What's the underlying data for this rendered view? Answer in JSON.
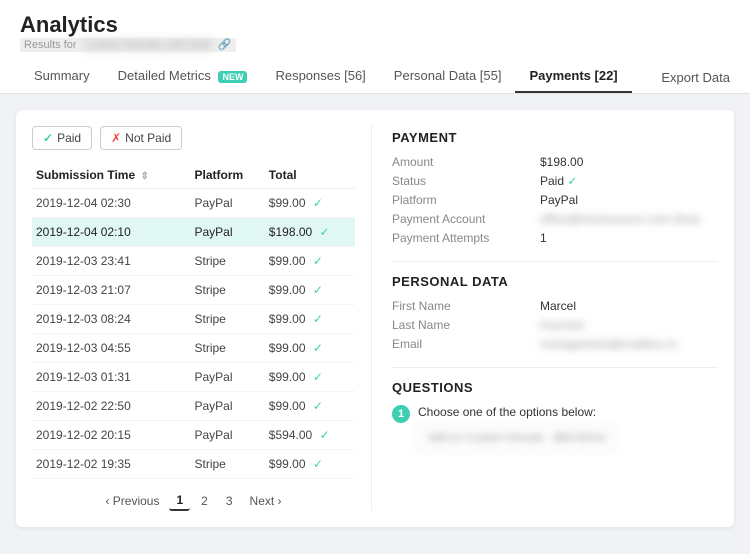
{
  "header": {
    "title": "Analytics",
    "subtitle": "Results for",
    "subtitle_deal": "Custom Domain (19) Deal",
    "tabs": [
      {
        "id": "summary",
        "label": "Summary",
        "active": false,
        "badge": null
      },
      {
        "id": "detailed-metrics",
        "label": "Detailed Metrics",
        "active": false,
        "badge": "NEW"
      },
      {
        "id": "responses",
        "label": "Responses [56]",
        "active": false,
        "badge": null
      },
      {
        "id": "personal-data",
        "label": "Personal Data [55]",
        "active": false,
        "badge": null
      },
      {
        "id": "payments",
        "label": "Payments [22]",
        "active": true,
        "badge": null
      }
    ],
    "export_label": "Export Data"
  },
  "filters": {
    "paid_label": "Paid",
    "not_paid_label": "Not Paid"
  },
  "table": {
    "columns": [
      "Submission Time",
      "Platform",
      "Total"
    ],
    "rows": [
      {
        "time": "2019-12-04 02:30",
        "platform": "PayPal",
        "total": "$99.00",
        "paid": true,
        "highlighted": false
      },
      {
        "time": "2019-12-04 02:10",
        "platform": "PayPal",
        "total": "$198.00",
        "paid": true,
        "highlighted": true
      },
      {
        "time": "2019-12-03 23:41",
        "platform": "Stripe",
        "total": "$99.00",
        "paid": true,
        "highlighted": false
      },
      {
        "time": "2019-12-03 21:07",
        "platform": "Stripe",
        "total": "$99.00",
        "paid": true,
        "highlighted": false
      },
      {
        "time": "2019-12-03 08:24",
        "platform": "Stripe",
        "total": "$99.00",
        "paid": true,
        "highlighted": false
      },
      {
        "time": "2019-12-03 04:55",
        "platform": "Stripe",
        "total": "$99.00",
        "paid": true,
        "highlighted": false
      },
      {
        "time": "2019-12-03 01:31",
        "platform": "PayPal",
        "total": "$99.00",
        "paid": true,
        "highlighted": false
      },
      {
        "time": "2019-12-02 22:50",
        "platform": "PayPal",
        "total": "$99.00",
        "paid": true,
        "highlighted": false
      },
      {
        "time": "2019-12-02 20:15",
        "platform": "PayPal",
        "total": "$594.00",
        "paid": true,
        "highlighted": false
      },
      {
        "time": "2019-12-02 19:35",
        "platform": "Stripe",
        "total": "$99.00",
        "paid": true,
        "highlighted": false
      }
    ]
  },
  "pagination": {
    "prev_label": "Previous",
    "next_label": "Next",
    "pages": [
      "1",
      "2",
      "3"
    ],
    "active_page": "1"
  },
  "payment_detail": {
    "section_title": "PAYMENT",
    "amount_label": "Amount",
    "amount_value": "$198.00",
    "status_label": "Status",
    "status_value": "Paid",
    "platform_label": "Platform",
    "platform_value": "PayPal",
    "account_label": "Payment Account",
    "account_value": "office@newssource.com (live)",
    "attempts_label": "Payment Attempts",
    "attempts_value": "1"
  },
  "personal_data": {
    "section_title": "PERSONAL DATA",
    "first_name_label": "First Name",
    "first_name_value": "Marcel",
    "last_name_label": "Last Name",
    "last_name_value": "Husman",
    "email_label": "Email",
    "email_value": "management@mailbox.ro"
  },
  "questions": {
    "section_title": "QUESTIONS",
    "items": [
      {
        "num": "1",
        "text": "Choose one of the options below:",
        "answer": "Add-on Custom Domain - $99.00/mo"
      }
    ]
  },
  "colors": {
    "accent": "#3ecfb2",
    "highlight_row": "#e0f7f4"
  }
}
